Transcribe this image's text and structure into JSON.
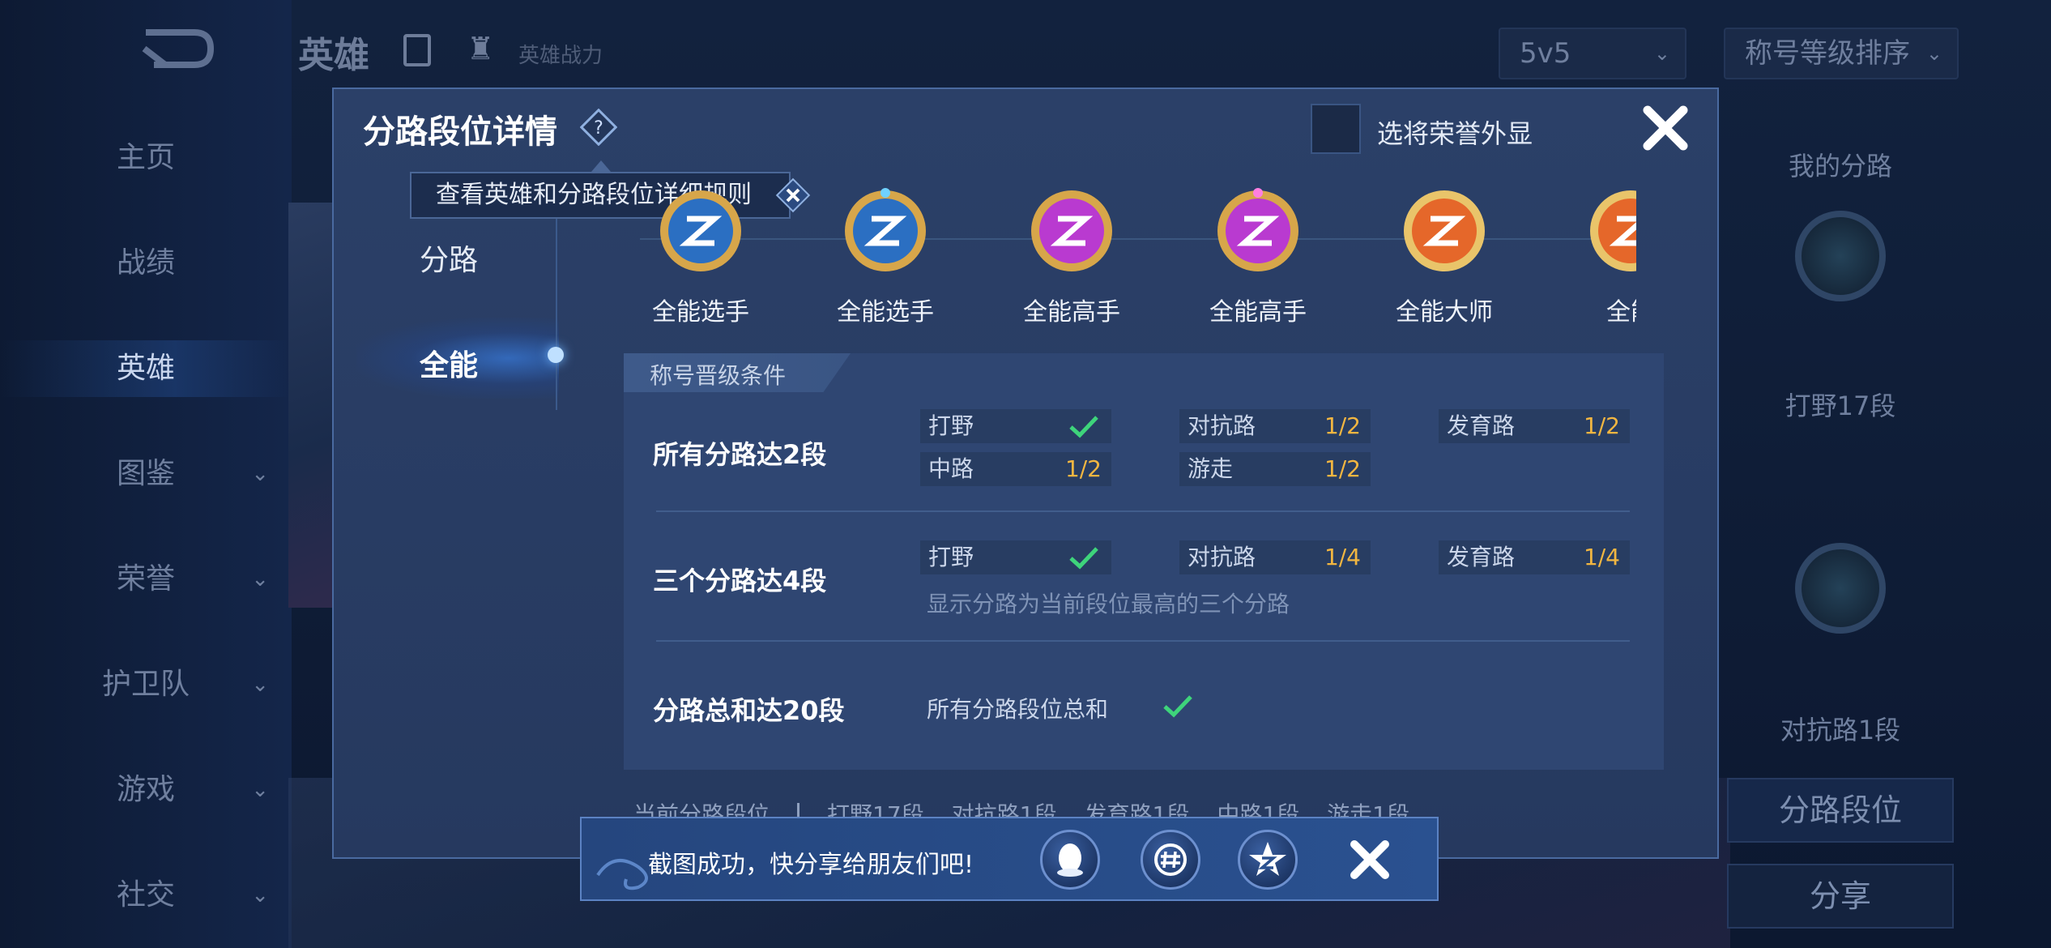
{
  "background": {
    "nav_items": [
      {
        "label": "主页",
        "chevron": false
      },
      {
        "label": "战绩",
        "chevron": false
      },
      {
        "label": "英雄",
        "chevron": false
      },
      {
        "label": "图鉴",
        "chevron": true
      },
      {
        "label": "荣誉",
        "chevron": true
      },
      {
        "label": "护卫队",
        "chevron": true
      },
      {
        "label": "游戏",
        "chevron": true
      },
      {
        "label": "社交",
        "chevron": true
      }
    ],
    "topbar_title": "英雄",
    "hero_power_label": "英雄战力",
    "mode_dropdown": "5v5",
    "sort_dropdown": "称号等级排序",
    "right_panel": {
      "title": "我的分路",
      "jungle_rank": "打野17段",
      "clash_rank": "对抗路1段",
      "lane_rank_button": "分路段位",
      "share_button": "分享"
    }
  },
  "dialog": {
    "title": "分路段位详情",
    "honor_display_label": "选将荣誉外显",
    "tooltip": "查看英雄和分路段位详细规则",
    "tabs": {
      "lane": "分路",
      "allround": "全能"
    },
    "badges": [
      {
        "name": "全能选手",
        "tier": "blue"
      },
      {
        "name": "全能选手",
        "tier": "blue"
      },
      {
        "name": "全能高手",
        "tier": "purple"
      },
      {
        "name": "全能高手",
        "tier": "purple"
      },
      {
        "name": "全能大师",
        "tier": "orange"
      },
      {
        "name": "全能",
        "tier": "orange"
      }
    ],
    "conditions_header": "称号晋级条件",
    "conditions": [
      {
        "title": "所有分路达2段",
        "chips": [
          {
            "label": "打野",
            "value": "",
            "done": true
          },
          {
            "label": "对抗路",
            "value": "1/2",
            "done": false
          },
          {
            "label": "发育路",
            "value": "1/2",
            "done": false
          },
          {
            "label": "中路",
            "value": "1/2",
            "done": false
          },
          {
            "label": "游走",
            "value": "1/2",
            "done": false
          }
        ]
      },
      {
        "title": "三个分路达4段",
        "chips": [
          {
            "label": "打野",
            "value": "",
            "done": true
          },
          {
            "label": "对抗路",
            "value": "1/4",
            "done": false
          },
          {
            "label": "发育路",
            "value": "1/4",
            "done": false
          }
        ],
        "note": "显示分路为当前段位最高的三个分路"
      },
      {
        "title": "分路总和达20段",
        "label": "所有分路段位总和",
        "done": true
      }
    ],
    "current_lanes_label": "当前分路段位",
    "current_lanes": [
      "打野17段",
      "对抗路1段",
      "发育路1段",
      "中路1段",
      "游走1段"
    ]
  },
  "toast": {
    "text": "截图成功，快分享给朋友们吧!",
    "share_targets": [
      "qq-icon",
      "hash-icon",
      "qzone-icon"
    ]
  },
  "colors": {
    "accent_value": "#f2b641",
    "check_green": "#3ed47b",
    "dialog_bg": "#2b4068"
  }
}
